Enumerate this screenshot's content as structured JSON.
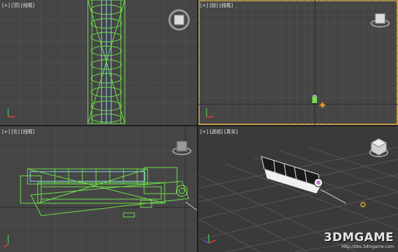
{
  "viewports": [
    {
      "id": "top",
      "label_parts": [
        "[+]",
        "[顶]",
        "[线框]"
      ]
    },
    {
      "id": "front",
      "label_parts": [
        "[+]",
        "[前]",
        "[线框]"
      ]
    },
    {
      "id": "left",
      "label_parts": [
        "[+]",
        "[左]",
        "[线框]"
      ]
    },
    {
      "id": "perspective",
      "label_parts": [
        "[+]",
        "[透视]",
        "[真实]"
      ]
    }
  ],
  "active_viewport": "front",
  "watermark": {
    "brand": "3DMGAME",
    "url": "http://bbs.3dmgame.com"
  },
  "colors": {
    "viewport_bg": "#454545",
    "grid": "#505050",
    "grid_axis": "#2a2a2a",
    "active_border": "#c8a24a",
    "wireframe": "#6fe04a",
    "wireframe_selected": "#8fd6ff"
  },
  "icons": [
    "viewcube-icon",
    "axis-tripod-icon",
    "pivot-gizmo-icon"
  ]
}
